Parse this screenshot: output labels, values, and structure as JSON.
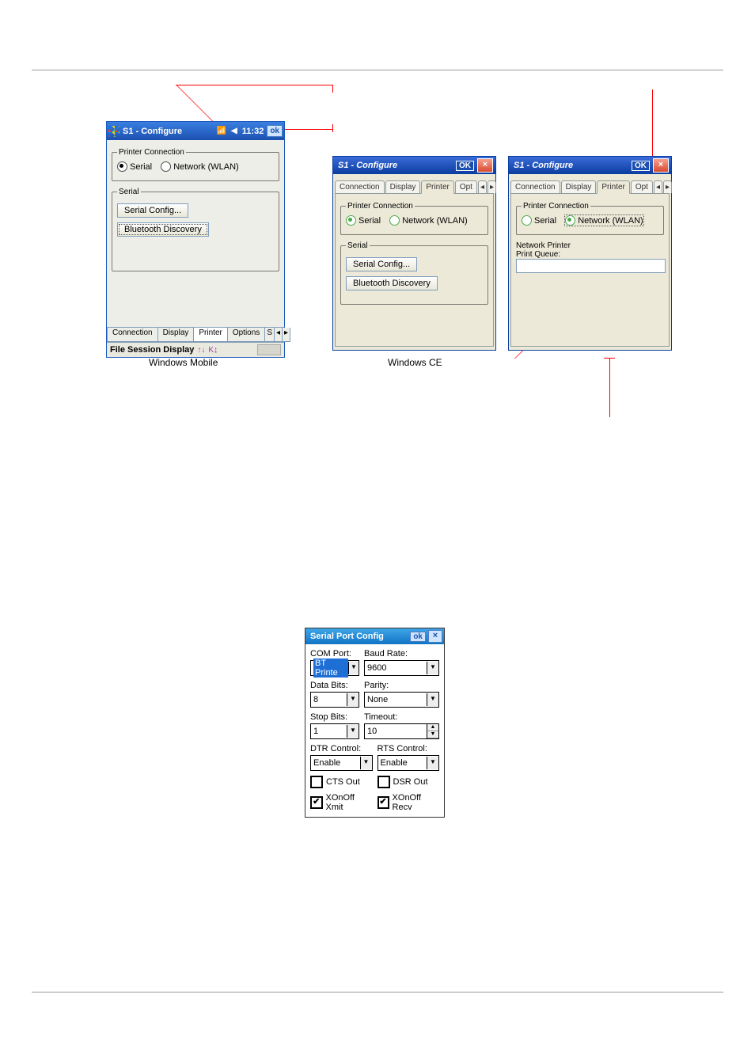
{
  "wm": {
    "title": "S1 - Configure",
    "time": "11:32",
    "ok": "ok",
    "fieldset_conn": "Printer Connection",
    "radio_serial": "Serial",
    "radio_network": "Network (WLAN)",
    "fieldset_serial": "Serial",
    "btn_serial_config": "Serial Config...",
    "btn_bt": "Bluetooth Discovery",
    "tabs": {
      "connection": "Connection",
      "display": "Display",
      "printer": "Printer",
      "options": "Options",
      "more": "S"
    },
    "footer": "File Session Display",
    "caption": "Windows Mobile"
  },
  "ce1": {
    "title": "S1 - Configure",
    "ok": "OK",
    "tabs": {
      "connection": "Connection",
      "display": "Display",
      "printer": "Printer",
      "options": "Opt"
    },
    "fieldset_conn": "Printer Connection",
    "radio_serial": "Serial",
    "radio_network": "Network (WLAN)",
    "fieldset_serial": "Serial",
    "btn_serial_config": "Serial Config...",
    "btn_bt": "Bluetooth Discovery"
  },
  "ce2": {
    "title": "S1 - Configure",
    "ok": "OK",
    "tabs": {
      "connection": "Connection",
      "display": "Display",
      "printer": "Printer",
      "options": "Opt"
    },
    "fieldset_conn": "Printer Connection",
    "radio_serial": "Serial",
    "radio_network": "Network (WLAN)",
    "group_network": "Network Printer",
    "lbl_queue": "Print Queue:",
    "queue_value": ""
  },
  "ce_caption": "Windows CE",
  "spc": {
    "title": "Serial Port Config",
    "ok": "ok",
    "com_port_lbl": "COM Port:",
    "com_port_val": "BT Printe",
    "baud_lbl": "Baud Rate:",
    "baud_val": "9600",
    "databits_lbl": "Data Bits:",
    "databits_val": "8",
    "parity_lbl": "Parity:",
    "parity_val": "None",
    "stopbits_lbl": "Stop Bits:",
    "stopbits_val": "1",
    "timeout_lbl": "Timeout:",
    "timeout_val": "10",
    "dtr_lbl": "DTR Control:",
    "dtr_val": "Enable",
    "rts_lbl": "RTS Control:",
    "rts_val": "Enable",
    "cts": "CTS Out",
    "dsr": "DSR Out",
    "xon_xmit": "XOnOff Xmit",
    "xon_recv": "XOnOff Recv"
  }
}
